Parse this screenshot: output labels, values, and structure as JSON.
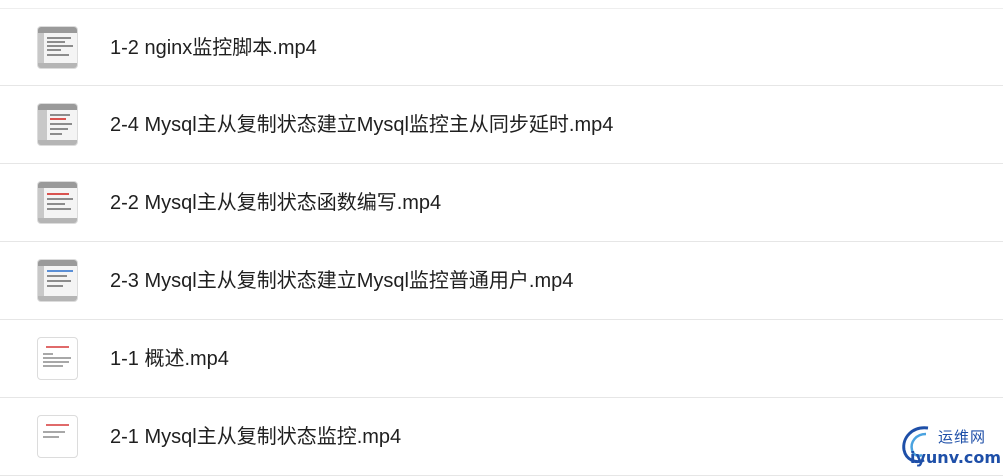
{
  "files": [
    {
      "name": "1-2 nginx监控脚本.mp4",
      "thumb": "video-frame"
    },
    {
      "name": "2-4 Mysql主从复制状态建立Mysql监控主从同步延时.mp4",
      "thumb": "video-frame"
    },
    {
      "name": "2-2 Mysql主从复制状态函数编写.mp4",
      "thumb": "video-frame"
    },
    {
      "name": "2-3 Mysql主从复制状态建立Mysql监控普通用户.mp4",
      "thumb": "video-frame"
    },
    {
      "name": "1-1 概述.mp4",
      "thumb": "slide-frame"
    },
    {
      "name": "2-1 Mysql主从复制状态监控.mp4",
      "thumb": "slide-frame"
    }
  ],
  "watermark": {
    "cn": "运维网",
    "en": "iyunv.com"
  }
}
